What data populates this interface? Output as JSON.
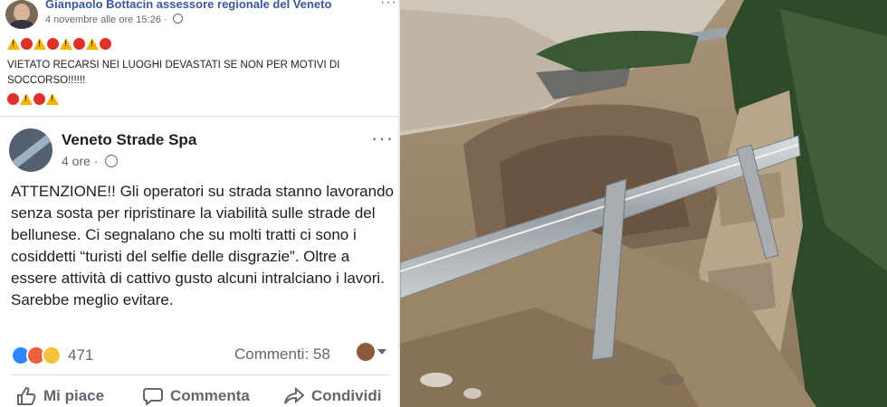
{
  "top_post": {
    "author": "Gianpaolo Bottacin assessore regionale del Veneto",
    "timestamp": "4 novembre alle ore 15:26",
    "privacy_icon": "globe-icon",
    "emoji_line_1": [
      "warning",
      "red-circle",
      "warning",
      "red-circle",
      "warning",
      "red-circle",
      "warning",
      "red-circle"
    ],
    "message": "VIETATO RECARSI NEI LUOGHI DEVASTATI SE NON PER MOTIVI DI SOCCORSO!!!!!!",
    "emoji_line_2": [
      "red-circle",
      "warning",
      "red-circle",
      "warning"
    ]
  },
  "shared_post": {
    "author": "Veneto Strade Spa",
    "timestamp": "4 ore",
    "message": "ATTENZIONE!! Gli operatori su strada stanno lavorando senza sosta per ripristinare la viabilità sulle strade del bellunese. Ci segnalano che su molti tratti ci sono i cosiddetti “turisti del selfie delle disgrazie”. Oltre a essere attività di cattivo gusto alcuni intralciano i lavori. Sarebbe meglio evitare.",
    "reaction_count": "471",
    "comments_label": "Commenti: 58",
    "actions": {
      "like": "Mi piace",
      "comment": "Commenta",
      "share": "Condividi"
    }
  },
  "colors": {
    "link_blue": "#385898",
    "text": "#1c1e21",
    "muted": "#606770",
    "warning": "#f5b400",
    "red": "#e0302a"
  }
}
